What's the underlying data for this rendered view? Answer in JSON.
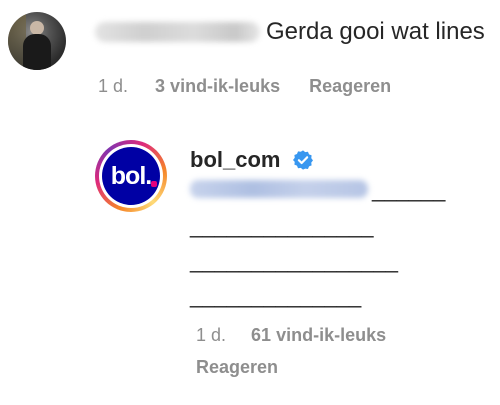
{
  "comment": {
    "text": "Gerda gooi wat lines",
    "time": "1 d.",
    "likes": "3 vind-ik-leuks",
    "reply_label": "Reageren"
  },
  "reply": {
    "username": "bol_com",
    "avatar_logo": "bol.",
    "verified_icon": "verified-badge-icon",
    "lines": [
      "______",
      "_______________",
      "_________________",
      "______________"
    ],
    "time": "1 d.",
    "likes": "61 vind-ik-leuks",
    "reply_label": "Reageren"
  },
  "colors": {
    "muted": "#8e8e8e",
    "text": "#262626",
    "verified": "#3897f0",
    "bol_blue": "#0000a4",
    "bol_pink": "#e5007e"
  }
}
